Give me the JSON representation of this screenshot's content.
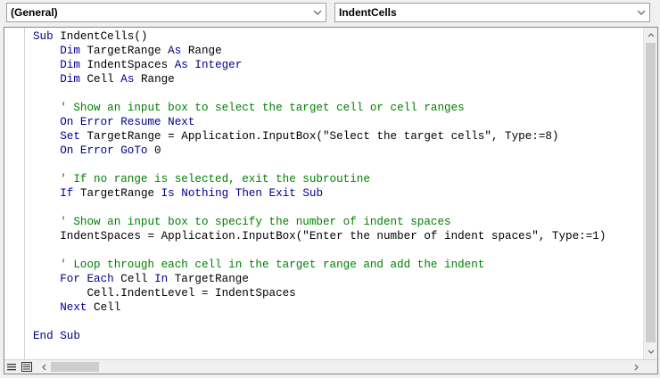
{
  "toolbar": {
    "object_combo": "(General)",
    "procedure_combo": "IndentCells"
  },
  "code_lines": [
    [
      {
        "t": "kw",
        "v": "Sub "
      },
      {
        "t": "plain",
        "v": "IndentCells()"
      }
    ],
    [
      {
        "t": "plain",
        "v": "    "
      },
      {
        "t": "kw",
        "v": "Dim "
      },
      {
        "t": "plain",
        "v": "TargetRange "
      },
      {
        "t": "kw",
        "v": "As "
      },
      {
        "t": "plain",
        "v": "Range"
      }
    ],
    [
      {
        "t": "plain",
        "v": "    "
      },
      {
        "t": "kw",
        "v": "Dim "
      },
      {
        "t": "plain",
        "v": "IndentSpaces "
      },
      {
        "t": "kw",
        "v": "As Integer"
      }
    ],
    [
      {
        "t": "plain",
        "v": "    "
      },
      {
        "t": "kw",
        "v": "Dim "
      },
      {
        "t": "plain",
        "v": "Cell "
      },
      {
        "t": "kw",
        "v": "As "
      },
      {
        "t": "plain",
        "v": "Range"
      }
    ],
    [],
    [
      {
        "t": "plain",
        "v": "    "
      },
      {
        "t": "cm",
        "v": "' Show an input box to select the target cell or cell ranges"
      }
    ],
    [
      {
        "t": "plain",
        "v": "    "
      },
      {
        "t": "kw",
        "v": "On Error Resume Next"
      }
    ],
    [
      {
        "t": "plain",
        "v": "    "
      },
      {
        "t": "kw",
        "v": "Set "
      },
      {
        "t": "plain",
        "v": "TargetRange = Application.InputBox(\"Select the target cells\", Type:=8)"
      }
    ],
    [
      {
        "t": "plain",
        "v": "    "
      },
      {
        "t": "kw",
        "v": "On Error GoTo "
      },
      {
        "t": "plain",
        "v": "0"
      }
    ],
    [],
    [
      {
        "t": "plain",
        "v": "    "
      },
      {
        "t": "cm",
        "v": "' If no range is selected, exit the subroutine"
      }
    ],
    [
      {
        "t": "plain",
        "v": "    "
      },
      {
        "t": "kw",
        "v": "If "
      },
      {
        "t": "plain",
        "v": "TargetRange "
      },
      {
        "t": "kw",
        "v": "Is Nothing Then Exit Sub"
      }
    ],
    [],
    [
      {
        "t": "plain",
        "v": "    "
      },
      {
        "t": "cm",
        "v": "' Show an input box to specify the number of indent spaces"
      }
    ],
    [
      {
        "t": "plain",
        "v": "    IndentSpaces = Application.InputBox(\"Enter the number of indent spaces\", Type:=1)"
      }
    ],
    [],
    [
      {
        "t": "plain",
        "v": "    "
      },
      {
        "t": "cm",
        "v": "' Loop through each cell in the target range and add the indent"
      }
    ],
    [
      {
        "t": "plain",
        "v": "    "
      },
      {
        "t": "kw",
        "v": "For Each "
      },
      {
        "t": "plain",
        "v": "Cell "
      },
      {
        "t": "kw",
        "v": "In "
      },
      {
        "t": "plain",
        "v": "TargetRange"
      }
    ],
    [
      {
        "t": "plain",
        "v": "        Cell.IndentLevel = IndentSpaces"
      }
    ],
    [
      {
        "t": "plain",
        "v": "    "
      },
      {
        "t": "kw",
        "v": "Next "
      },
      {
        "t": "plain",
        "v": "Cell"
      }
    ],
    [],
    [
      {
        "t": "kw",
        "v": "End Sub"
      }
    ]
  ],
  "colors": {
    "keyword": "#00008b",
    "comment": "#008000",
    "text": "#000000"
  },
  "icons": {
    "dropdown": "chevron-down-icon",
    "procedure_view": "procedure-view-icon",
    "full_module_view": "full-module-view-icon",
    "scroll_up": "chevron-up-icon",
    "scroll_down": "chevron-down-icon",
    "scroll_left": "chevron-left-icon",
    "scroll_right": "chevron-right-icon"
  }
}
